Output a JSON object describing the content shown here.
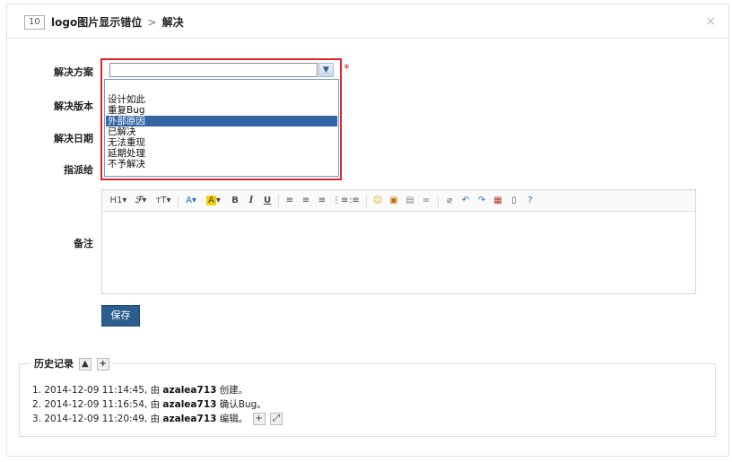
{
  "header": {
    "id": "10",
    "title": "logo图片显示错位",
    "separator": ">",
    "action": "解决",
    "close": "×"
  },
  "form": {
    "resolution_label": "解决方案",
    "resolution_value": "",
    "required_mark": "*",
    "resolution_options": [
      "设计如此",
      "重复Bug",
      "外部原因",
      "已解决",
      "无法重现",
      "延期处理",
      "不予解决"
    ],
    "highlighted_option": "外部原因",
    "version_label": "解决版本",
    "date_label": "解决日期",
    "assign_label": "指派给",
    "comment_label": "备注",
    "save_label": "保存"
  },
  "editor_toolbar": [
    "H1",
    "font-family",
    "font-size",
    "font-color",
    "highlight",
    "B",
    "I",
    "U",
    "align-left",
    "align-center",
    "align-right",
    "ordered-list",
    "unordered-list",
    "emoticon",
    "image",
    "flash",
    "link",
    "eraser",
    "undo",
    "redo",
    "table",
    "paste",
    "help"
  ],
  "history": {
    "title": "历史记录",
    "items": [
      {
        "n": "1.",
        "time": "2014-12-09 11:14:45,",
        "by": "由",
        "user": "azalea713",
        "action": "创建。"
      },
      {
        "n": "2.",
        "time": "2014-12-09 11:16:54,",
        "by": "由",
        "user": "azalea713",
        "action": "确认Bug。"
      },
      {
        "n": "3.",
        "time": "2014-12-09 11:20:49,",
        "by": "由",
        "user": "azalea713",
        "action": "编辑。"
      }
    ]
  },
  "colors": {
    "accent": "#2b5e8e",
    "required": "#d9262b",
    "highlight": "#3465a4"
  }
}
